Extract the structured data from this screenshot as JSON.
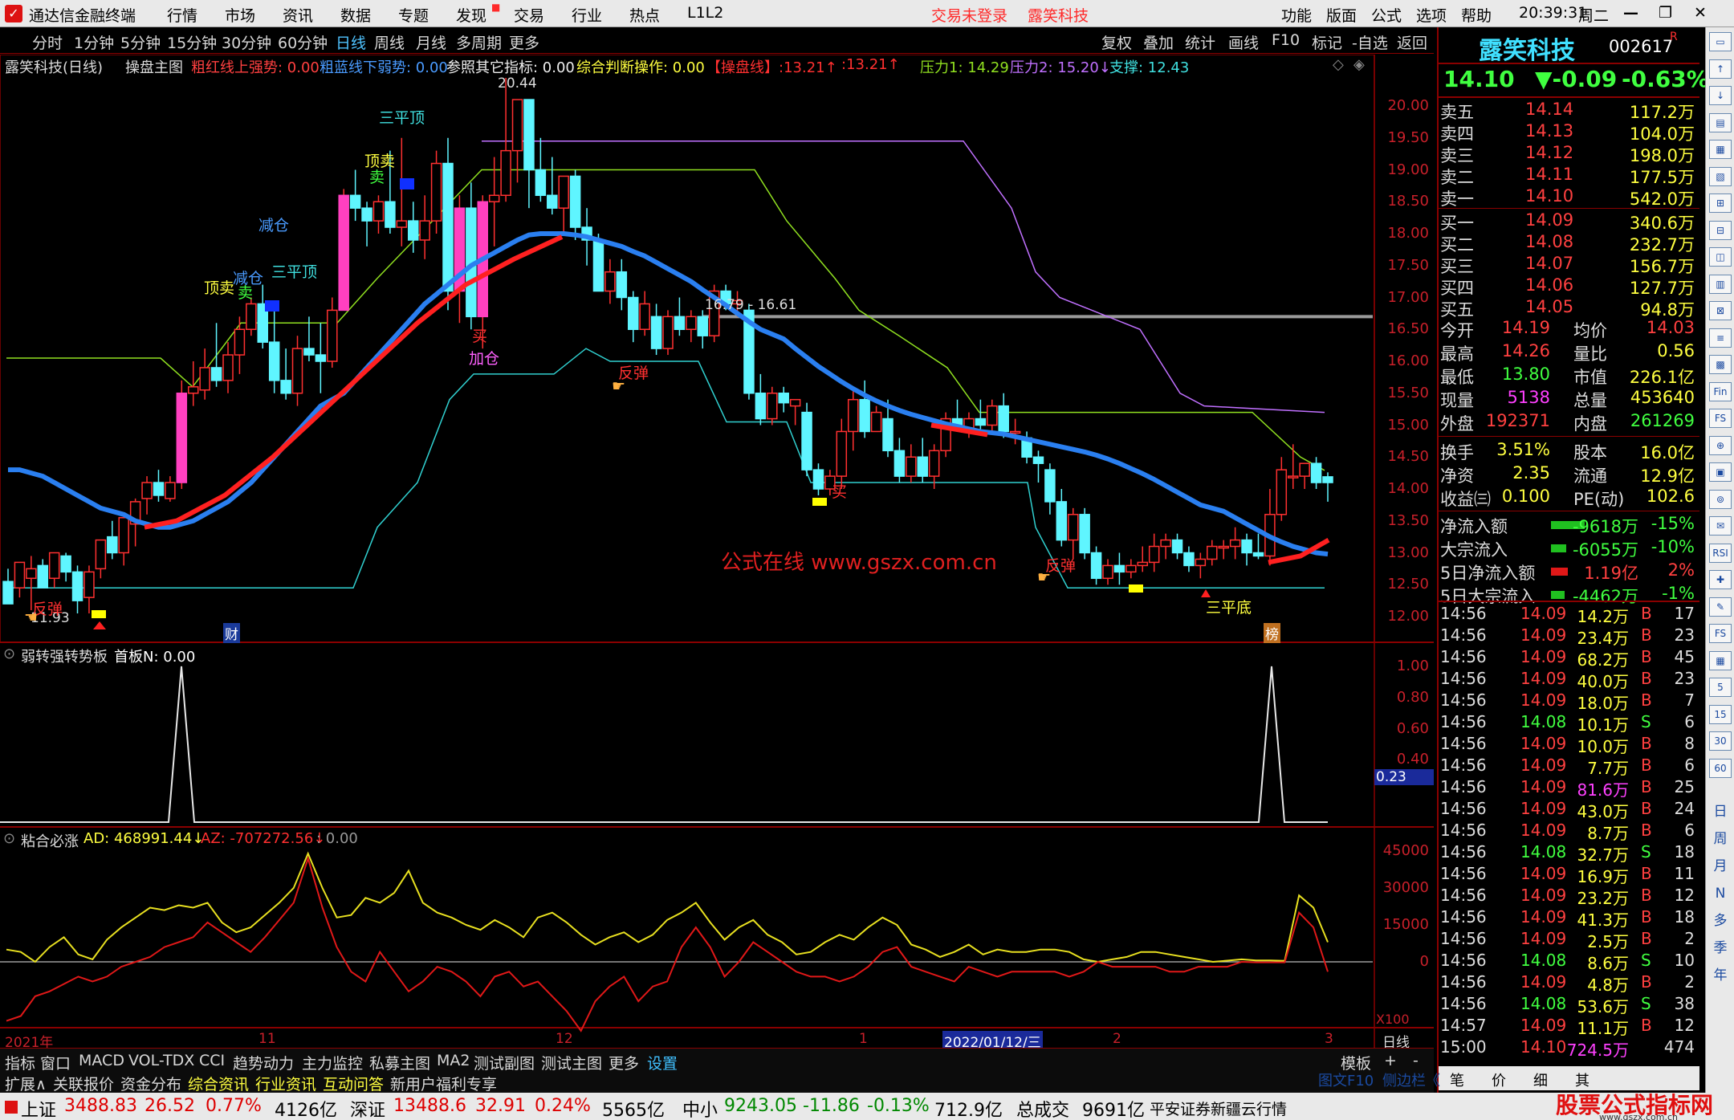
{
  "menubar": {
    "app": "通达信金融终端",
    "items": [
      "行情",
      "市场",
      "资讯",
      "数据",
      "专题",
      "发现",
      "交易",
      "行业",
      "热点",
      "L1L2"
    ],
    "login": "交易未登录",
    "stock": "露笑科技",
    "right": [
      "功能",
      "版面",
      "公式",
      "选项",
      "帮助"
    ],
    "time": "20:39:31",
    "weekday": "周二"
  },
  "periods": [
    "分时",
    "1分钟",
    "5分钟",
    "15分钟",
    "30分钟",
    "60分钟",
    "日线",
    "周线",
    "月线",
    "多周期",
    "更多"
  ],
  "tools": [
    "复权",
    "叠加",
    "统计",
    "画线",
    "F10",
    "标记",
    "-自选",
    "返回"
  ],
  "main_header": {
    "name": "露笑科技(日线)",
    "formula": "操盘主图",
    "i1": "粗红线上强势: 0.00",
    "i2": "粗蓝线下弱势: 0.00",
    "i3": "参照其它指标: 0.00",
    "i4": "综合判断操作: 0.00",
    "i5": "【操盘线】:13.21↑",
    "i6": ":13.21↑",
    "i7": "压力1: 14.29",
    "i8": "压力2: 15.20↓",
    "i9": "支撑: 12.43"
  },
  "main_axis": [
    "20.00",
    "19.50",
    "19.00",
    "18.50",
    "18.00",
    "17.50",
    "17.00",
    "16.50",
    "16.00",
    "15.50",
    "15.00",
    "14.50",
    "14.00",
    "13.50",
    "13.00",
    "12.50",
    "12.00"
  ],
  "annotations": {
    "max": "20.44",
    "min": "11.93",
    "hline": "16.79 - 16.61",
    "top3a": "三平顶",
    "top3b": "三平顶",
    "sell1": "顶卖",
    "sell2": "顶卖",
    "sellsub1": "卖",
    "sellsub2": "卖",
    "red1": "减仓",
    "red2": "减仓",
    "buy1": "买",
    "buy2": "买",
    "add": "加仓",
    "rb1": "反弹",
    "rb2": "反弹",
    "rb3": "反弹",
    "bottom": "三平底",
    "watermark": "公式在线  www.gszx.com.cn",
    "cai": "财",
    "bang": "榜"
  },
  "sub1": {
    "title": "弱转强转势板",
    "val": "首板N: 0.00",
    "axis": [
      "1.00",
      "0.80",
      "0.60",
      "0.40"
    ],
    "cur": "0.23"
  },
  "sub2": {
    "title": "粘合必涨",
    "ad": "AD: 468991.44↓",
    "az": "AZ: -707272.56↓",
    "z": ": 0.00",
    "axis": [
      "45000",
      "30000",
      "15000",
      "0"
    ],
    "unit": "X100"
  },
  "xaxis": {
    "l1": "2021年",
    "l2": "11",
    "l3": "12",
    "l4": "1",
    "cursor": "2022/01/12/三",
    "l5": "2",
    "l6": "3",
    "per": "日线"
  },
  "bottom_tabs": [
    "指标",
    "窗口",
    "MACD",
    "VOL-TDX",
    "CCI",
    "趋势动力",
    "主力监控",
    "私募主图",
    "MA2",
    "测试副图",
    "测试主图",
    "更多",
    "设置"
  ],
  "bottom_tabs2": [
    "扩展∧",
    "关联报价",
    "资金分布",
    "综合资讯",
    "行业资讯",
    "互动问答",
    "新用户福利专享"
  ],
  "right_small": [
    "模板",
    "+",
    "-"
  ],
  "side": {
    "name": "露笑科技",
    "code": "002617",
    "r": "R",
    "price": "14.10",
    "chg": "▼-0.09",
    "pct": "-0.63%",
    "asks": [
      [
        "卖五",
        "14.14",
        "117.2万"
      ],
      [
        "卖四",
        "14.13",
        "104.0万"
      ],
      [
        "卖三",
        "14.12",
        "198.0万"
      ],
      [
        "卖二",
        "14.11",
        "177.5万"
      ],
      [
        "卖一",
        "14.10",
        "542.0万"
      ]
    ],
    "bids": [
      [
        "买一",
        "14.09",
        "340.6万"
      ],
      [
        "买二",
        "14.08",
        "232.7万"
      ],
      [
        "买三",
        "14.07",
        "156.7万"
      ],
      [
        "买四",
        "14.06",
        "127.7万"
      ],
      [
        "买五",
        "14.05",
        "94.8万"
      ]
    ],
    "stats": [
      [
        "今开",
        "14.19",
        "均价",
        "14.03"
      ],
      [
        "最高",
        "14.26",
        "量比",
        "0.56"
      ],
      [
        "最低",
        "13.80",
        "市值",
        "226.1亿"
      ],
      [
        "现量",
        "5138",
        "总量",
        "453640"
      ],
      [
        "外盘",
        "192371",
        "内盘",
        "261269"
      ]
    ],
    "stats2": [
      [
        "换手",
        "3.51%",
        "股本",
        "16.0亿"
      ],
      [
        "净资",
        "2.35",
        "流通",
        "12.9亿"
      ],
      [
        "收益㈢",
        "0.100",
        "PE(动)",
        "102.6"
      ]
    ],
    "flows": [
      [
        "净流入额",
        "-9618万",
        "-15%"
      ],
      [
        "大宗流入",
        "-6055万",
        "-10%"
      ],
      [
        "5日净流入额",
        "1.19亿",
        "2%"
      ],
      [
        "5日大宗流入",
        "-4462万",
        "-1%"
      ]
    ],
    "ticks": [
      [
        "14:56",
        "14.09",
        "14.2万",
        "B",
        "17"
      ],
      [
        "14:56",
        "14.09",
        "23.4万",
        "B",
        "23"
      ],
      [
        "14:56",
        "14.09",
        "68.2万",
        "B",
        "45"
      ],
      [
        "14:56",
        "14.09",
        "40.0万",
        "B",
        "23"
      ],
      [
        "14:56",
        "14.09",
        "18.0万",
        "B",
        "7"
      ],
      [
        "14:56",
        "14.08",
        "10.1万",
        "S",
        "6"
      ],
      [
        "14:56",
        "14.09",
        "10.0万",
        "B",
        "8"
      ],
      [
        "14:56",
        "14.09",
        "7.7万",
        "B",
        "6"
      ],
      [
        "14:56",
        "14.09",
        "81.6万",
        "B",
        "25"
      ],
      [
        "14:56",
        "14.09",
        "43.0万",
        "B",
        "24"
      ],
      [
        "14:56",
        "14.09",
        "8.7万",
        "B",
        "6"
      ],
      [
        "14:56",
        "14.08",
        "32.7万",
        "S",
        "18"
      ],
      [
        "14:56",
        "14.09",
        "16.9万",
        "B",
        "11"
      ],
      [
        "14:56",
        "14.09",
        "23.2万",
        "B",
        "12"
      ],
      [
        "14:56",
        "14.09",
        "41.3万",
        "B",
        "18"
      ],
      [
        "14:56",
        "14.09",
        "2.5万",
        "B",
        "2"
      ],
      [
        "14:56",
        "14.08",
        "8.6万",
        "S",
        "10"
      ],
      [
        "14:56",
        "14.09",
        "4.8万",
        "B",
        "2"
      ],
      [
        "14:56",
        "14.08",
        "53.6万",
        "S",
        "38"
      ],
      [
        "14:57",
        "14.09",
        "11.1万",
        "B",
        "12"
      ],
      [
        "15:00",
        "14.10",
        "724.5万",
        "",
        "474"
      ]
    ],
    "bottom": [
      "图文F10",
      "侧边栏《",
      "笔",
      "价",
      "细",
      "其"
    ]
  },
  "vtool": [
    "日",
    "周",
    "月",
    "N",
    "多",
    "季",
    "年"
  ],
  "status": {
    "sh": "上证",
    "shv": "3488.83",
    "shc": "26.52",
    "shp": "0.77%",
    "sha": "4126亿",
    "sz": "深证",
    "szv": "13488.6",
    "szc": "32.91",
    "szp": "0.24%",
    "sza": "5565亿",
    "zx": "中小",
    "zxv": "9243.05",
    "zxc": "-11.86",
    "zxp": "-0.13%",
    "zxa": "712.9亿",
    "tot": "总成交",
    "tota": "9691亿",
    "broker": "平安证券新疆云行情",
    "brand": "股票公式指标网",
    "brandurl": "www.gszx.com.cn"
  },
  "chart_data": {
    "type": "candlestick",
    "ylim": [
      11.8,
      20.6
    ],
    "candles": [
      [
        12.55,
        12.75,
        12.3,
        12.2
      ],
      [
        12.45,
        12.75,
        12.3,
        12.85
      ],
      [
        12.6,
        12.95,
        12.1,
        12.75
      ],
      [
        12.8,
        12.9,
        12.45,
        12.45
      ],
      [
        12.6,
        12.9,
        12.45,
        13.0
      ],
      [
        12.95,
        13.0,
        12.55,
        12.7
      ],
      [
        12.7,
        12.8,
        12.05,
        12.25
      ],
      [
        12.3,
        12.8,
        12.05,
        12.7
      ],
      [
        12.75,
        13.2,
        12.6,
        13.2
      ],
      [
        13.25,
        13.5,
        12.9,
        13.0
      ],
      [
        13.0,
        13.55,
        12.8,
        13.55
      ],
      [
        13.45,
        13.85,
        13.1,
        13.8
      ],
      [
        13.85,
        14.2,
        13.6,
        14.1
      ],
      [
        14.1,
        14.3,
        13.8,
        13.9
      ],
      [
        13.85,
        14.2,
        13.8,
        14.1
      ],
      [
        14.1,
        15.7,
        14.0,
        15.5
      ],
      [
        15.5,
        16.0,
        15.3,
        15.6
      ],
      [
        15.55,
        16.2,
        15.4,
        15.9
      ],
      [
        15.9,
        16.6,
        15.6,
        15.7
      ],
      [
        15.7,
        16.3,
        15.5,
        16.1
      ],
      [
        16.1,
        16.7,
        15.8,
        16.5
      ],
      [
        16.5,
        17.0,
        16.4,
        16.9
      ],
      [
        16.9,
        17.2,
        16.2,
        16.3
      ],
      [
        16.3,
        16.9,
        15.5,
        15.7
      ],
      [
        15.7,
        16.2,
        15.4,
        15.5
      ],
      [
        15.5,
        16.4,
        15.3,
        16.2
      ],
      [
        16.2,
        16.7,
        16.0,
        16.1
      ],
      [
        16.1,
        16.6,
        15.5,
        16.0
      ],
      [
        16.0,
        17.0,
        15.9,
        16.8
      ],
      [
        16.8,
        18.7,
        16.8,
        18.6
      ],
      [
        18.6,
        19.0,
        18.2,
        18.4
      ],
      [
        18.4,
        18.5,
        17.8,
        18.2
      ],
      [
        18.2,
        18.6,
        18.0,
        18.5
      ],
      [
        18.5,
        19.3,
        18.0,
        18.1
      ],
      [
        18.1,
        19.5,
        17.8,
        18.2
      ],
      [
        18.2,
        18.5,
        17.7,
        17.9
      ],
      [
        17.9,
        18.6,
        17.6,
        18.2
      ],
      [
        18.2,
        19.3,
        18.0,
        19.1
      ],
      [
        19.1,
        19.5,
        16.8,
        17.1
      ],
      [
        17.1,
        18.6,
        16.6,
        18.4
      ],
      [
        18.4,
        18.8,
        16.5,
        16.7
      ],
      [
        16.7,
        18.6,
        16.2,
        18.5
      ],
      [
        18.5,
        19.2,
        17.8,
        18.6
      ],
      [
        18.6,
        20.44,
        18.5,
        19.3
      ],
      [
        19.3,
        20.1,
        18.8,
        20.1
      ],
      [
        20.1,
        19.1,
        18.4,
        19.0
      ],
      [
        19.0,
        19.5,
        18.5,
        18.6
      ],
      [
        18.6,
        19.2,
        18.3,
        18.4
      ],
      [
        18.4,
        18.9,
        18.0,
        18.9
      ],
      [
        18.9,
        19.0,
        17.9,
        18.1
      ],
      [
        18.1,
        18.4,
        17.5,
        17.9
      ],
      [
        17.9,
        18.0,
        17.2,
        17.1
      ],
      [
        17.1,
        17.6,
        16.9,
        17.4
      ],
      [
        17.4,
        17.6,
        16.8,
        17.0
      ],
      [
        17.0,
        17.1,
        16.3,
        16.5
      ],
      [
        16.5,
        17.1,
        16.4,
        16.9
      ],
      [
        16.7,
        16.9,
        16.1,
        16.2
      ],
      [
        16.2,
        16.8,
        16.1,
        16.7
      ],
      [
        16.7,
        17.0,
        16.4,
        16.5
      ],
      [
        16.5,
        16.8,
        16.3,
        16.7
      ],
      [
        16.7,
        16.8,
        16.2,
        16.4
      ],
      [
        16.4,
        17.2,
        16.3,
        17.1
      ],
      [
        17.1,
        17.2,
        16.8,
        16.9
      ],
      [
        16.9,
        17.1,
        16.7,
        16.95
      ],
      [
        16.8,
        16.9,
        15.4,
        15.5
      ],
      [
        15.5,
        15.8,
        15.0,
        15.1
      ],
      [
        15.1,
        15.6,
        15.0,
        15.5
      ],
      [
        15.5,
        15.6,
        15.2,
        15.35
      ],
      [
        15.3,
        15.4,
        15.0,
        15.4
      ],
      [
        15.2,
        15.35,
        14.2,
        14.3
      ],
      [
        14.3,
        14.4,
        13.9,
        14.0
      ],
      [
        14.0,
        14.3,
        13.9,
        14.2
      ],
      [
        14.2,
        15.1,
        14.0,
        14.9
      ],
      [
        14.9,
        15.6,
        14.6,
        15.4
      ],
      [
        15.4,
        15.7,
        14.8,
        14.9
      ],
      [
        14.9,
        15.3,
        14.9,
        15.2
      ],
      [
        15.1,
        15.4,
        14.5,
        14.6
      ],
      [
        14.6,
        14.8,
        14.1,
        14.2
      ],
      [
        14.2,
        14.7,
        14.1,
        14.5
      ],
      [
        14.5,
        14.8,
        14.1,
        14.2
      ],
      [
        14.2,
        14.7,
        14.0,
        14.6
      ],
      [
        14.6,
        15.2,
        14.5,
        15.1
      ],
      [
        15.1,
        15.4,
        14.9,
        14.95
      ],
      [
        14.95,
        15.2,
        14.8,
        15.1
      ],
      [
        15.1,
        15.4,
        14.9,
        15.0
      ],
      [
        15.0,
        15.4,
        14.9,
        15.3
      ],
      [
        15.3,
        15.5,
        14.8,
        14.9
      ],
      [
        14.9,
        15.1,
        14.7,
        14.9
      ],
      [
        14.8,
        14.9,
        14.4,
        14.5
      ],
      [
        14.5,
        14.6,
        14.1,
        14.4
      ],
      [
        14.3,
        14.4,
        13.6,
        13.8
      ],
      [
        13.8,
        14.0,
        13.1,
        13.2
      ],
      [
        13.2,
        13.7,
        12.9,
        13.6
      ],
      [
        13.6,
        13.7,
        12.9,
        13.0
      ],
      [
        13.0,
        13.1,
        12.5,
        12.6
      ],
      [
        12.6,
        12.9,
        12.5,
        12.8
      ],
      [
        12.8,
        13.0,
        12.5,
        12.7
      ],
      [
        12.7,
        12.9,
        12.6,
        12.8
      ],
      [
        12.8,
        13.1,
        12.7,
        12.85
      ],
      [
        12.85,
        13.3,
        12.7,
        13.1
      ],
      [
        13.1,
        13.3,
        12.9,
        13.2
      ],
      [
        13.2,
        13.3,
        12.9,
        13.0
      ],
      [
        13.0,
        13.1,
        12.7,
        12.8
      ],
      [
        12.8,
        13.0,
        12.6,
        12.9
      ],
      [
        12.9,
        13.2,
        12.8,
        13.1
      ],
      [
        13.1,
        13.2,
        12.9,
        13.1
      ],
      [
        13.1,
        13.4,
        12.9,
        13.2
      ],
      [
        13.2,
        13.3,
        12.8,
        13.0
      ],
      [
        13.0,
        13.3,
        12.9,
        12.95
      ],
      [
        12.95,
        14.0,
        12.8,
        13.6
      ],
      [
        13.6,
        14.5,
        13.5,
        14.3
      ],
      [
        14.2,
        14.7,
        14.0,
        14.2
      ],
      [
        14.2,
        14.4,
        14.0,
        14.4
      ],
      [
        14.4,
        14.5,
        14.0,
        14.1
      ],
      [
        14.19,
        14.26,
        13.8,
        14.1
      ]
    ],
    "ma_blue": [
      14.3,
      14.3,
      14.25,
      14.2,
      14.1,
      14.0,
      13.9,
      13.8,
      13.7,
      13.6,
      13.5,
      13.45,
      13.4,
      13.4,
      13.45,
      13.5,
      13.6,
      13.7,
      13.8,
      13.95,
      14.1,
      14.3,
      14.5,
      14.7,
      14.9,
      15.1,
      15.3,
      15.5,
      15.7,
      15.9,
      16.1,
      16.3,
      16.5,
      16.7,
      16.9,
      17.05,
      17.2,
      17.35,
      17.5,
      17.6,
      17.7,
      17.8,
      17.9,
      17.98,
      18.0,
      18.0,
      17.98,
      17.95,
      17.9,
      17.85,
      17.8,
      17.72,
      17.65,
      17.55,
      17.45,
      17.35,
      17.25,
      17.12,
      17.0,
      16.88,
      16.75,
      16.62,
      16.5,
      16.35,
      16.2,
      16.06,
      15.92,
      15.8,
      15.68,
      15.57,
      15.47,
      15.38,
      15.3,
      15.23,
      15.17,
      15.12,
      15.07,
      15.02,
      14.98,
      14.94,
      14.9,
      14.86,
      14.82,
      14.78,
      14.74,
      14.7,
      14.66,
      14.62,
      14.58,
      14.53,
      14.47,
      14.4,
      14.32,
      14.24,
      14.15,
      14.05,
      13.95,
      13.85,
      13.75,
      13.65,
      13.55,
      13.45,
      13.35,
      13.25,
      13.17,
      13.1,
      13.05,
      13.0,
      12.98
    ],
    "ma_red": [
      13.5,
      13.45,
      13.45,
      13.5,
      13.6,
      13.7,
      13.85,
      14.0,
      14.2,
      14.4,
      14.6,
      14.85,
      15.1,
      15.35,
      15.6,
      15.85,
      16.1,
      16.35,
      16.6,
      16.85,
      17.1,
      17.3,
      17.5,
      17.65,
      17.8,
      17.9,
      18.0,
      18.0,
      13.2,
      13.3
    ],
    "sub1_peaks": [
      1,
      1
    ]
  }
}
